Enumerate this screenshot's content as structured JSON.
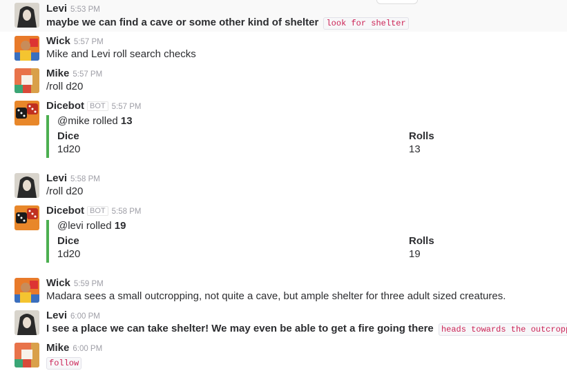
{
  "messages": [
    {
      "user": "Levi",
      "time": "5:53 PM",
      "text": "maybe we can find a cave or some other kind of shelter",
      "code": "look for shelter",
      "avatar": "levi-avatar"
    },
    {
      "user": "Wick",
      "time": "5:57 PM",
      "text": "Mike and Levi roll search checks",
      "avatar": "wick-avatar"
    },
    {
      "user": "Mike",
      "time": "5:57 PM",
      "text": "/roll d20",
      "avatar": "mike-avatar"
    },
    {
      "user": "Dicebot",
      "badge": "BOT",
      "time": "5:57 PM",
      "attachment": {
        "mention": "@mike rolled ",
        "result": "13",
        "dice_label": "Dice",
        "dice_value": "1d20",
        "rolls_label": "Rolls",
        "rolls_value": "13"
      },
      "avatar": "dice-avatar"
    },
    {
      "user": "Levi",
      "time": "5:58 PM",
      "text": "/roll d20",
      "avatar": "levi-avatar"
    },
    {
      "user": "Dicebot",
      "badge": "BOT",
      "time": "5:58 PM",
      "attachment": {
        "mention": "@levi rolled ",
        "result": "19",
        "dice_label": "Dice",
        "dice_value": "1d20",
        "rolls_label": "Rolls",
        "rolls_value": "19"
      },
      "avatar": "dice-avatar"
    },
    {
      "user": "Wick",
      "time": "5:59 PM",
      "text": "Madara sees a small outcropping, not quite a cave, but ample shelter for three adult sized creatures.",
      "avatar": "wick-avatar"
    },
    {
      "user": "Levi",
      "time": "6:00 PM",
      "text": "I see a place we can take shelter! We may even be able to get a fire going there",
      "code": "heads towards the outcropping",
      "avatar": "levi-avatar"
    },
    {
      "user": "Mike",
      "time": "6:00 PM",
      "text": "",
      "code": "follow",
      "avatar": "mike-avatar"
    }
  ],
  "colors": {
    "attachment_bar": "#4caf50",
    "code_text": "#cc2255"
  }
}
